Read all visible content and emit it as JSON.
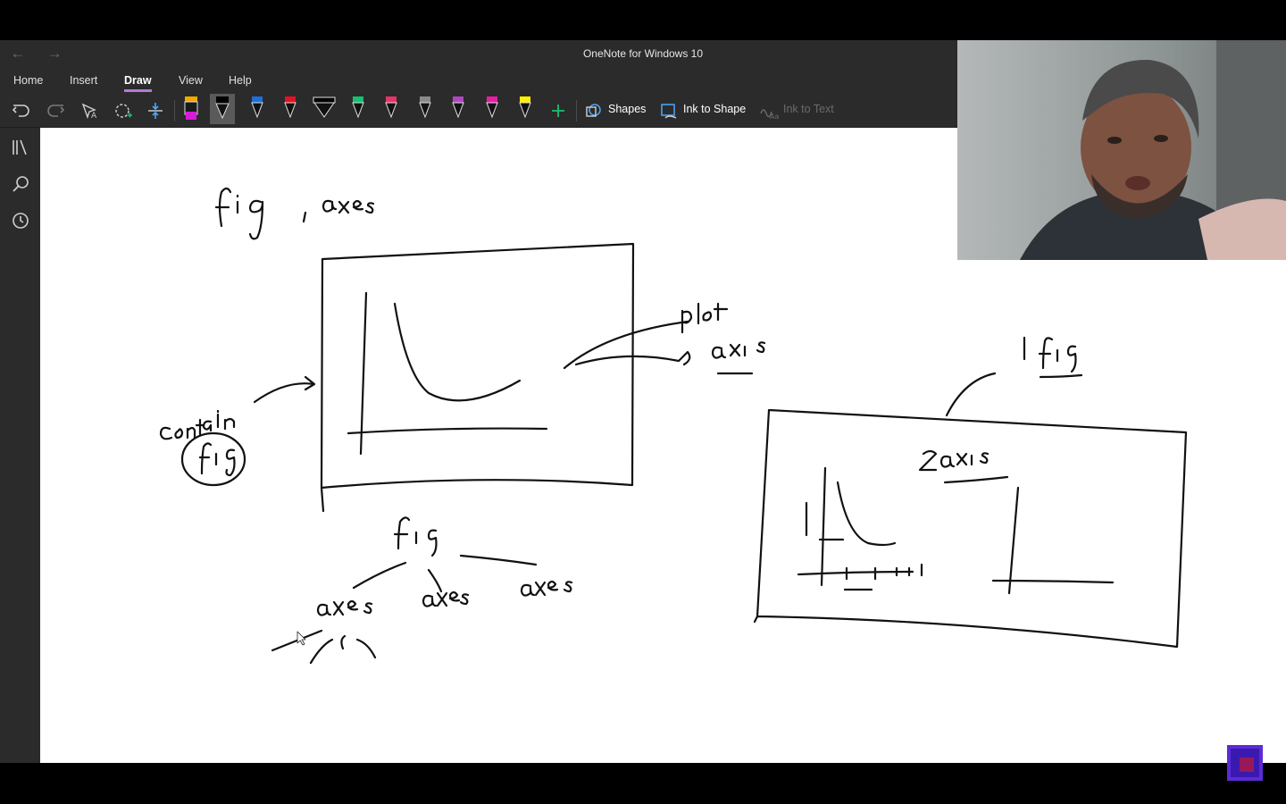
{
  "window": {
    "title": "OneNote for Windows 10"
  },
  "nav": {
    "back_icon": "back-arrow-icon",
    "forward_icon": "forward-arrow-icon"
  },
  "menu": {
    "tabs": [
      {
        "label": "Home"
      },
      {
        "label": "Insert"
      },
      {
        "label": "Draw",
        "active": true
      },
      {
        "label": "View"
      },
      {
        "label": "Help"
      }
    ],
    "accent_color": "#b27cd8"
  },
  "toolbar": {
    "pens": [
      {
        "icon": "highlighter-icon",
        "color": "#d81bd8"
      },
      {
        "icon": "pen-icon",
        "color": "#000000",
        "selected": true
      },
      {
        "icon": "pen-icon",
        "color": "#1e6fd9"
      },
      {
        "icon": "pen-icon",
        "color": "#e81123"
      },
      {
        "icon": "calligraphy-pen-icon",
        "color": "#000000"
      },
      {
        "icon": "pen-icon",
        "color": "#16c172"
      },
      {
        "icon": "pen-icon",
        "color": "#e8336a"
      },
      {
        "icon": "pencil-icon",
        "color": "#8a8a8a"
      },
      {
        "icon": "pen-icon",
        "color": "#b146c2"
      },
      {
        "icon": "highlighter-icon",
        "color": "#e81ca6"
      },
      {
        "icon": "highlighter-icon",
        "color": "#fff100"
      }
    ],
    "shapes_label": "Shapes",
    "ink_to_shape_label": "Ink to Shape",
    "ink_to_text_label": "Ink to Text"
  },
  "sidebar": {
    "items": [
      {
        "icon": "notebooks-icon"
      },
      {
        "icon": "search-icon"
      },
      {
        "icon": "recent-icon"
      }
    ]
  },
  "canvas": {
    "handwriting": [
      "fig , axes",
      "plot",
      "axis",
      "contain",
      "fig",
      "1 fig",
      "2axis",
      "fig",
      "axes",
      "axes",
      "axes"
    ]
  },
  "webcam": {
    "description_icon": "webcam-presenter-video"
  }
}
